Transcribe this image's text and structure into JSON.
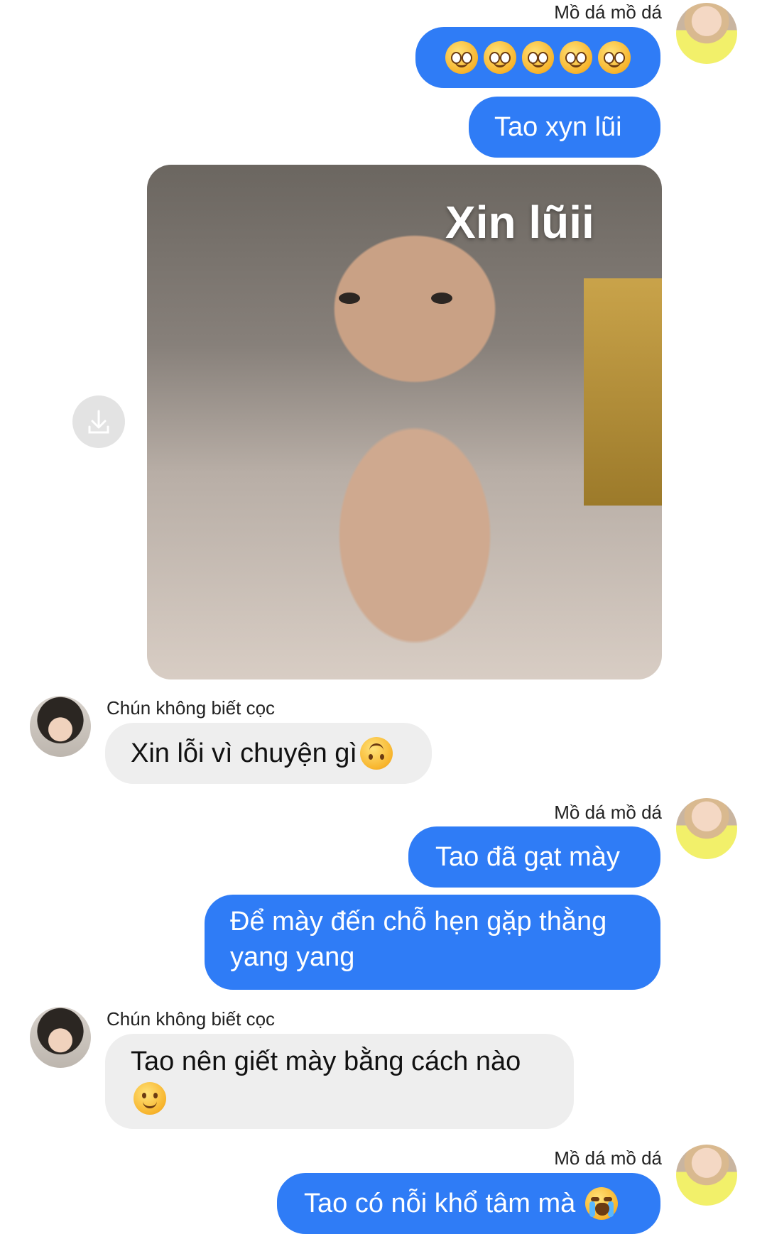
{
  "messages": {
    "group1": {
      "sender": "Mồ dá mồ dá",
      "emoji_row": [
        "pleading-face",
        "pleading-face",
        "pleading-face",
        "pleading-face",
        "pleading-face"
      ],
      "text": "Tao xyn lũi",
      "image_caption": "Xin lũii"
    },
    "group2": {
      "sender": "Chún không biết cọc",
      "text": "Xin lỗi vì chuyện gì",
      "emoji": "upside-down-face"
    },
    "group3": {
      "sender": "Mồ dá mồ dá",
      "text1": "Tao đã gạt mày",
      "text2": "Để mày đến chỗ hẹn gặp thằng yang yang"
    },
    "group4": {
      "sender": "Chún không biết cọc",
      "text": "Tao nên giết mày bằng cách nào",
      "emoji": "slightly-smiling-face"
    },
    "group5": {
      "sender": "Mồ dá mồ dá",
      "text": "Tao có nỗi khổ tâm mà",
      "emoji": "loudly-crying-face"
    }
  },
  "colors": {
    "outgoing_bubble": "#2f7cf6",
    "incoming_bubble": "#eeeeee"
  }
}
